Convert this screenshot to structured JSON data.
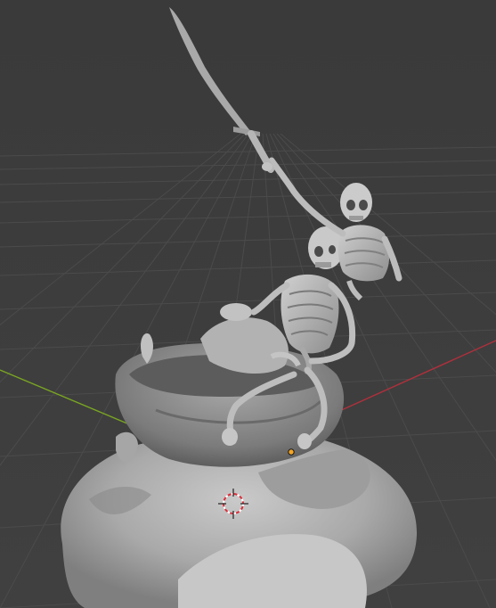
{
  "viewport": {
    "background_color": "#3d3d3d",
    "grid_color": "#4a4a4a",
    "x_axis_color": "#b0303c",
    "y_axis_color": "#7aa622",
    "model_color": "#b8b8b8",
    "model_shadow_color": "#6c6c6c",
    "origin_dot_color": "#f5a623",
    "icons": {
      "scene_model": "sculpted-skeletons-model-icon",
      "cursor": "3d-cursor-icon",
      "origin": "object-origin-icon"
    }
  }
}
